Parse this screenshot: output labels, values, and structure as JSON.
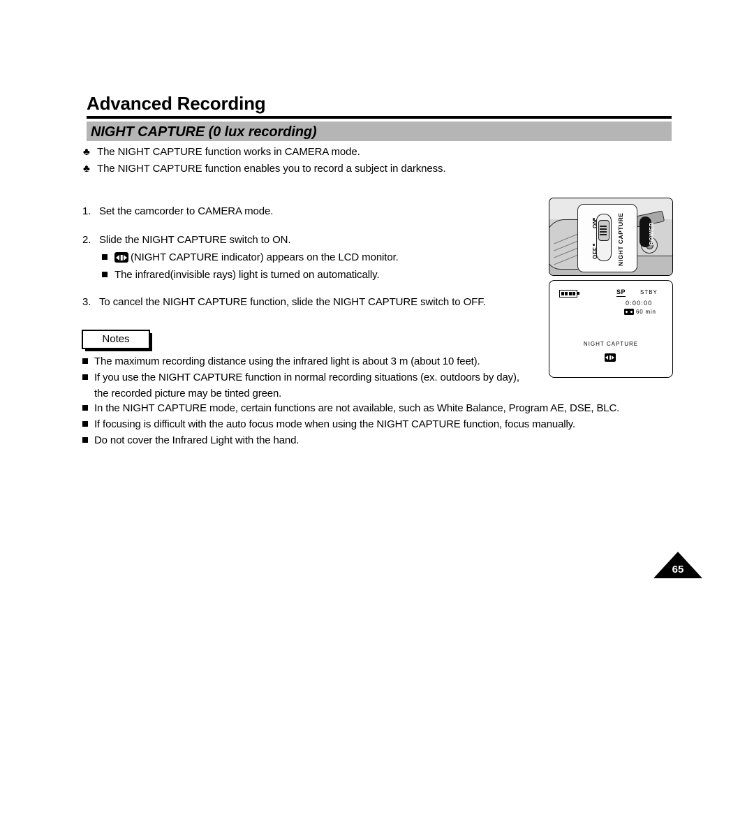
{
  "page": {
    "chapter_title": "Advanced Recording",
    "section_title": "NIGHT CAPTURE (0 lux recording)",
    "page_number": "65",
    "accent_gray": "#b5b5b5",
    "ink": "#000000"
  },
  "intro": {
    "bullet_glyph": "♣",
    "items": [
      "The NIGHT CAPTURE function works in CAMERA mode.",
      "The NIGHT CAPTURE function enables you to record a subject in darkness."
    ]
  },
  "steps": [
    {
      "number": "1.",
      "text": "Set the camcorder to CAMERA mode.",
      "substeps": []
    },
    {
      "number": "2.",
      "text": "Slide the NIGHT CAPTURE switch to ON.",
      "substeps": [
        {
          "icon": "night-capture-indicator-icon",
          "text": "(NIGHT CAPTURE indicator) appears on the LCD monitor."
        },
        {
          "icon": "",
          "text": "The infrared(invisible rays) light is turned on automatically."
        }
      ]
    },
    {
      "number": "3.",
      "text": "To cancel the NIGHT CAPTURE function, slide the NIGHT CAPTURE switch to OFF.",
      "substeps": []
    }
  ],
  "notes": {
    "label": "Notes",
    "items": [
      {
        "line1": "The maximum recording distance using the infrared light is about 3 m (about 10 feet).",
        "line2": ""
      },
      {
        "line1": "If you use the NIGHT CAPTURE function in normal recording situations (ex. outdoors by day),",
        "line2": "the recorded picture may be tinted green."
      },
      {
        "line1": "In the NIGHT CAPTURE mode, certain functions are not available, such as White Balance, Program AE, DSE, BLC.",
        "line2": ""
      },
      {
        "line1": "If focusing is difficult with the auto focus mode when using the NIGHT CAPTURE function, focus manually.",
        "line2": ""
      },
      {
        "line1": "Do not cover the Infrared Light with the hand.",
        "line2": ""
      }
    ]
  },
  "camcorder_photo": {
    "switch_label": "NIGHT CAPTURE",
    "position_on": "ON",
    "position_off": "OFF",
    "power_label": "POWER"
  },
  "lcd_display": {
    "record_mode": "SP",
    "status": "STBY",
    "timecode": "0:00:00",
    "tape_remaining": "60 min",
    "osd_label": "NIGHT CAPTURE",
    "battery_icon": "battery-icon",
    "tape_icon": "cassette-icon",
    "indicator_icon": "night-capture-indicator-icon"
  }
}
